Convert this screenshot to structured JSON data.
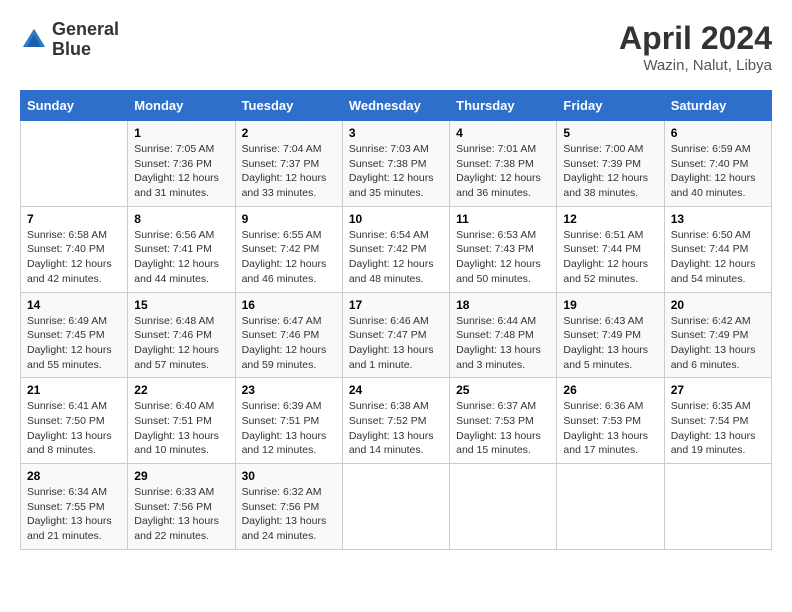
{
  "header": {
    "logo_line1": "General",
    "logo_line2": "Blue",
    "title": "April 2024",
    "subtitle": "Wazin, Nalut, Libya"
  },
  "columns": [
    "Sunday",
    "Monday",
    "Tuesday",
    "Wednesday",
    "Thursday",
    "Friday",
    "Saturday"
  ],
  "weeks": [
    [
      {
        "num": "",
        "info": ""
      },
      {
        "num": "1",
        "info": "Sunrise: 7:05 AM\nSunset: 7:36 PM\nDaylight: 12 hours\nand 31 minutes."
      },
      {
        "num": "2",
        "info": "Sunrise: 7:04 AM\nSunset: 7:37 PM\nDaylight: 12 hours\nand 33 minutes."
      },
      {
        "num": "3",
        "info": "Sunrise: 7:03 AM\nSunset: 7:38 PM\nDaylight: 12 hours\nand 35 minutes."
      },
      {
        "num": "4",
        "info": "Sunrise: 7:01 AM\nSunset: 7:38 PM\nDaylight: 12 hours\nand 36 minutes."
      },
      {
        "num": "5",
        "info": "Sunrise: 7:00 AM\nSunset: 7:39 PM\nDaylight: 12 hours\nand 38 minutes."
      },
      {
        "num": "6",
        "info": "Sunrise: 6:59 AM\nSunset: 7:40 PM\nDaylight: 12 hours\nand 40 minutes."
      }
    ],
    [
      {
        "num": "7",
        "info": "Sunrise: 6:58 AM\nSunset: 7:40 PM\nDaylight: 12 hours\nand 42 minutes."
      },
      {
        "num": "8",
        "info": "Sunrise: 6:56 AM\nSunset: 7:41 PM\nDaylight: 12 hours\nand 44 minutes."
      },
      {
        "num": "9",
        "info": "Sunrise: 6:55 AM\nSunset: 7:42 PM\nDaylight: 12 hours\nand 46 minutes."
      },
      {
        "num": "10",
        "info": "Sunrise: 6:54 AM\nSunset: 7:42 PM\nDaylight: 12 hours\nand 48 minutes."
      },
      {
        "num": "11",
        "info": "Sunrise: 6:53 AM\nSunset: 7:43 PM\nDaylight: 12 hours\nand 50 minutes."
      },
      {
        "num": "12",
        "info": "Sunrise: 6:51 AM\nSunset: 7:44 PM\nDaylight: 12 hours\nand 52 minutes."
      },
      {
        "num": "13",
        "info": "Sunrise: 6:50 AM\nSunset: 7:44 PM\nDaylight: 12 hours\nand 54 minutes."
      }
    ],
    [
      {
        "num": "14",
        "info": "Sunrise: 6:49 AM\nSunset: 7:45 PM\nDaylight: 12 hours\nand 55 minutes."
      },
      {
        "num": "15",
        "info": "Sunrise: 6:48 AM\nSunset: 7:46 PM\nDaylight: 12 hours\nand 57 minutes."
      },
      {
        "num": "16",
        "info": "Sunrise: 6:47 AM\nSunset: 7:46 PM\nDaylight: 12 hours\nand 59 minutes."
      },
      {
        "num": "17",
        "info": "Sunrise: 6:46 AM\nSunset: 7:47 PM\nDaylight: 13 hours\nand 1 minute."
      },
      {
        "num": "18",
        "info": "Sunrise: 6:44 AM\nSunset: 7:48 PM\nDaylight: 13 hours\nand 3 minutes."
      },
      {
        "num": "19",
        "info": "Sunrise: 6:43 AM\nSunset: 7:49 PM\nDaylight: 13 hours\nand 5 minutes."
      },
      {
        "num": "20",
        "info": "Sunrise: 6:42 AM\nSunset: 7:49 PM\nDaylight: 13 hours\nand 6 minutes."
      }
    ],
    [
      {
        "num": "21",
        "info": "Sunrise: 6:41 AM\nSunset: 7:50 PM\nDaylight: 13 hours\nand 8 minutes."
      },
      {
        "num": "22",
        "info": "Sunrise: 6:40 AM\nSunset: 7:51 PM\nDaylight: 13 hours\nand 10 minutes."
      },
      {
        "num": "23",
        "info": "Sunrise: 6:39 AM\nSunset: 7:51 PM\nDaylight: 13 hours\nand 12 minutes."
      },
      {
        "num": "24",
        "info": "Sunrise: 6:38 AM\nSunset: 7:52 PM\nDaylight: 13 hours\nand 14 minutes."
      },
      {
        "num": "25",
        "info": "Sunrise: 6:37 AM\nSunset: 7:53 PM\nDaylight: 13 hours\nand 15 minutes."
      },
      {
        "num": "26",
        "info": "Sunrise: 6:36 AM\nSunset: 7:53 PM\nDaylight: 13 hours\nand 17 minutes."
      },
      {
        "num": "27",
        "info": "Sunrise: 6:35 AM\nSunset: 7:54 PM\nDaylight: 13 hours\nand 19 minutes."
      }
    ],
    [
      {
        "num": "28",
        "info": "Sunrise: 6:34 AM\nSunset: 7:55 PM\nDaylight: 13 hours\nand 21 minutes."
      },
      {
        "num": "29",
        "info": "Sunrise: 6:33 AM\nSunset: 7:56 PM\nDaylight: 13 hours\nand 22 minutes."
      },
      {
        "num": "30",
        "info": "Sunrise: 6:32 AM\nSunset: 7:56 PM\nDaylight: 13 hours\nand 24 minutes."
      },
      {
        "num": "",
        "info": ""
      },
      {
        "num": "",
        "info": ""
      },
      {
        "num": "",
        "info": ""
      },
      {
        "num": "",
        "info": ""
      }
    ]
  ]
}
